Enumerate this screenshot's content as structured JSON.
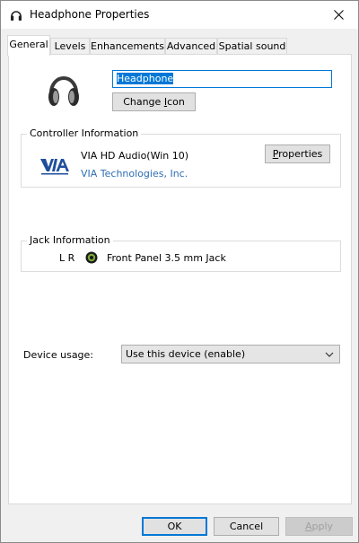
{
  "window": {
    "title": "Headphone Properties",
    "icon": "headphone-icon",
    "close_icon": "close-icon"
  },
  "tabs": [
    {
      "label": "General",
      "active": true
    },
    {
      "label": "Levels",
      "active": false
    },
    {
      "label": "Enhancements",
      "active": false
    },
    {
      "label": "Advanced",
      "active": false
    },
    {
      "label": "Spatial sound",
      "active": false
    }
  ],
  "device": {
    "name": "Headphone",
    "change_icon_pre": "Change ",
    "change_icon_key": "I",
    "change_icon_post": "con"
  },
  "controller": {
    "group_label": "Controller Information",
    "name": "VIA HD Audio(Win 10)",
    "manufacturer": "VIA Technologies, Inc.",
    "logo": "via-logo",
    "properties_key": "P",
    "properties_rest": "roperties"
  },
  "jack": {
    "group_label": "Jack Information",
    "channels": "L R",
    "description": "Front Panel 3.5 mm Jack",
    "jack_icon": "jack-dot-icon"
  },
  "usage": {
    "label": "Device usage:",
    "selected": "Use this device (enable)"
  },
  "buttons": {
    "ok": "OK",
    "cancel": "Cancel",
    "apply_key": "A",
    "apply_rest": "pply"
  },
  "colors": {
    "accent": "#0078d7",
    "link": "#2e6db4",
    "panel": "#ffffff",
    "chrome": "#f0f0f0"
  }
}
